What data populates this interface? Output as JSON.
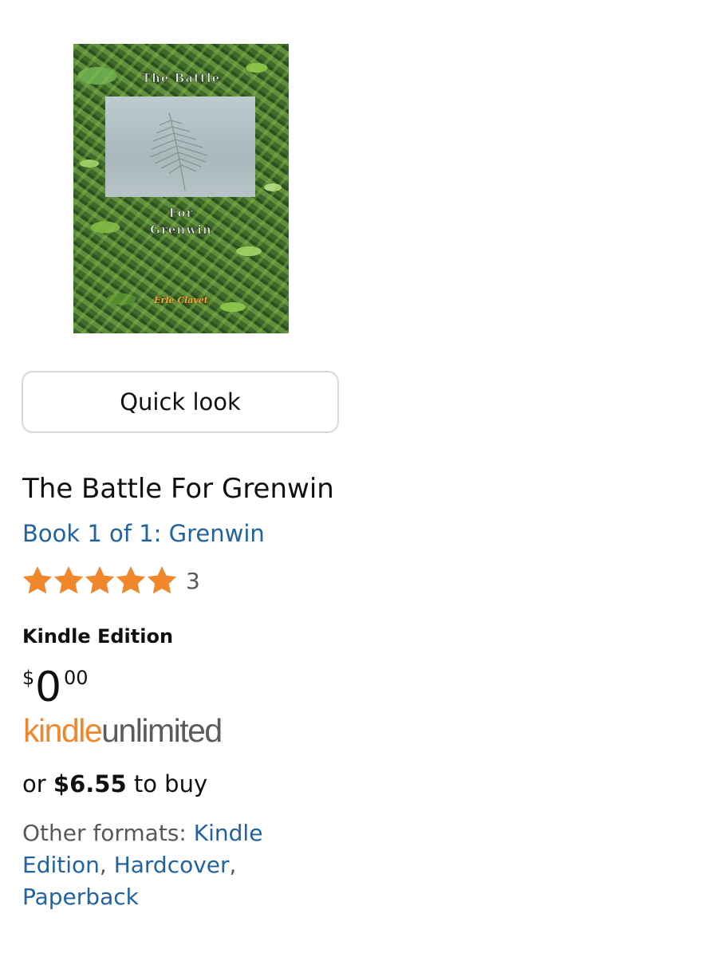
{
  "cover": {
    "title_line1": "The Battle",
    "title_line2": "For",
    "title_line3": "Grenwin",
    "author": "Erle Clavet"
  },
  "quick_look_label": "Quick look",
  "product": {
    "title": "The Battle For Grenwin",
    "series": "Book 1 of 1: Grenwin",
    "rating": {
      "stars": 5,
      "max": 5,
      "count": "3"
    },
    "format": "Kindle Edition",
    "price": {
      "symbol": "$",
      "whole": "0",
      "fraction": "00"
    },
    "kindle_unlimited": {
      "part1": "kindle",
      "part2": "unlimited"
    },
    "buy": {
      "prefix": "or",
      "price": "$6.55",
      "suffix": "to buy"
    },
    "other_formats": {
      "label": "Other formats:",
      "items": [
        "Kindle Edition",
        "Hardcover",
        "Paperback"
      ]
    }
  },
  "colors": {
    "link": "#2162a1",
    "star": "#f0872a",
    "kindle_orange": "#f0872a",
    "muted_text": "#565959"
  },
  "icons": {
    "rating_star": "star-icon"
  }
}
